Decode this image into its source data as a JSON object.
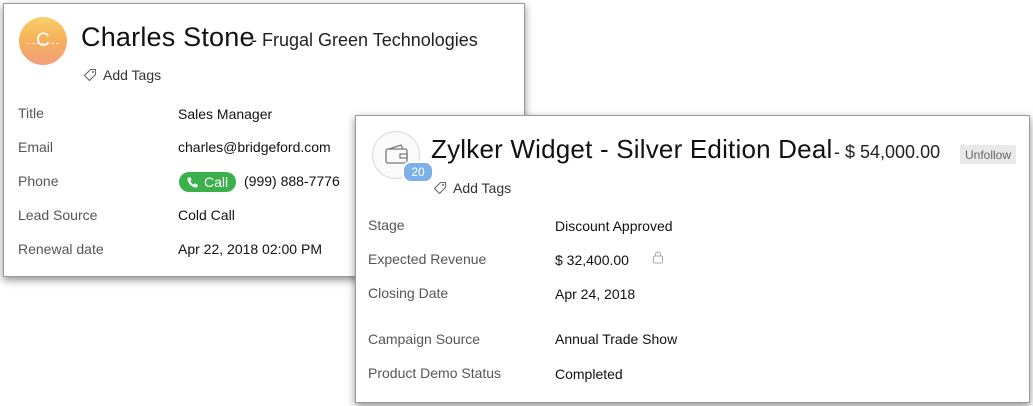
{
  "contact": {
    "avatar_initial": "C",
    "name": "Charles Stone",
    "company": "- Frugal Green Technologies",
    "add_tags": "Add Tags",
    "fields": [
      {
        "label": "Title",
        "value": "Sales Manager"
      },
      {
        "label": "Email",
        "value": "charles@bridgeford.com"
      },
      {
        "label": "Phone",
        "value": "(999) 888-7776"
      },
      {
        "label": "Lead Source",
        "value": "Cold Call"
      },
      {
        "label": "Renewal date",
        "value": "Apr 22, 2018 02:00 PM"
      }
    ],
    "call_label": "Call",
    "colors": {
      "call": "#3cb04a",
      "avatar": "#f6b25a"
    }
  },
  "deal": {
    "badge_count": "20",
    "title": "Zylker Widget - Silver Edition Deal",
    "amount": "- $ 54,000.00",
    "unfollow_label": "Unfollow",
    "add_tags": "Add Tags",
    "fields": [
      {
        "label": "Stage",
        "value": "Discount Approved"
      },
      {
        "label": "Expected Revenue",
        "value": "$ 32,400.00"
      },
      {
        "label": "Closing Date",
        "value": "Apr 24, 2018"
      },
      {
        "label": "Campaign Source",
        "value": "Annual Trade Show"
      },
      {
        "label": "Product Demo Status",
        "value": "Completed"
      }
    ],
    "icons": {
      "deal": "wallet-icon",
      "lock": "lock-icon",
      "tag": "tag-icon"
    }
  }
}
